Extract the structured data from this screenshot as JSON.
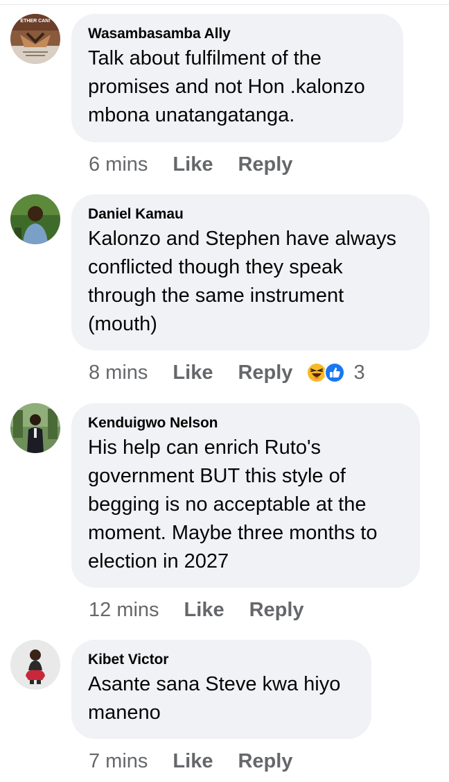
{
  "comments": [
    {
      "author": "Wasambasamba Ally",
      "text": "Talk about fulfilment of the\npromises and not Hon .kalonzo\nmbona unatangatanga.",
      "time": "6 mins",
      "like": "Like",
      "reply": "Reply",
      "avatar_text": "ETHER CAN!"
    },
    {
      "author": "Daniel Kamau",
      "text": "Kalonzo and Stephen have always\nconflicted though they speak\nthrough the same instrument\n(mouth)",
      "time": "8 mins",
      "like": "Like",
      "reply": "Reply",
      "reactions": {
        "icons": [
          "haha-icon",
          "like-icon"
        ],
        "count": "3"
      }
    },
    {
      "author": "Kenduigwo Nelson",
      "text": "His help can enrich Ruto's\ngovernment BUT this style of\nbegging is no acceptable at the\nmoment. Maybe three months to\nelection in 2027",
      "time": "12 mins",
      "like": "Like",
      "reply": "Reply"
    },
    {
      "author": "Kibet Victor",
      "text": "Asante sana Steve kwa hiyo\nmaneno",
      "time": "7 mins",
      "like": "Like",
      "reply": "Reply"
    }
  ],
  "colors": {
    "bubble": "#f0f2f5",
    "meta_text": "#65676b",
    "like_blue": "#1877f2",
    "haha_yellow": "#f7b928"
  }
}
